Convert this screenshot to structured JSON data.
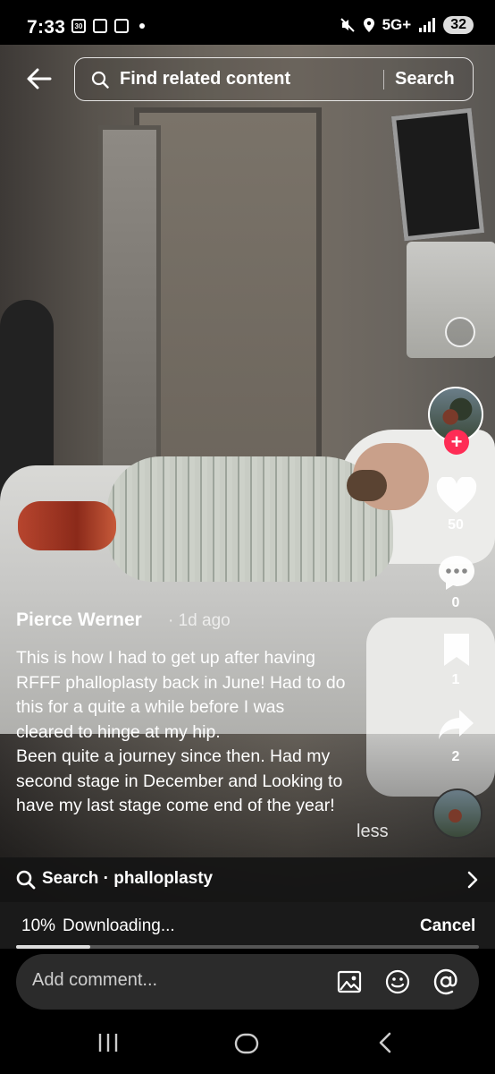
{
  "status_bar": {
    "time": "7:33",
    "date_badge": "30",
    "network": "5G+",
    "battery": "32"
  },
  "top_bar": {
    "search_placeholder": "Find related content",
    "search_button": "Search"
  },
  "rail": {
    "likes": "50",
    "comments": "0",
    "saves": "1",
    "shares": "2",
    "follow_symbol": "+"
  },
  "post": {
    "author": "Pierce Werner",
    "posted": "· 1d ago",
    "caption_lines": [
      "This is how I had to get up after having",
      "RFFF phalloplasty back in June! Had to do",
      "this for a quite a while before I was",
      "cleared to hinge at my hip.",
      "Been quite a journey since then. Had my",
      "second stage in December and Looking to",
      "have my last stage come end of the year!"
    ],
    "less": "less"
  },
  "related_search": {
    "label": "Search · phalloplasty"
  },
  "download": {
    "percent_label": "10%",
    "percent_value": 0.16,
    "status": "Downloading...",
    "cancel": "Cancel"
  },
  "comment_bar": {
    "placeholder": "Add comment..."
  },
  "icons": {
    "back": "arrow-left-icon",
    "search": "search-icon",
    "like": "heart-icon",
    "comment": "speech-bubble-icon",
    "save": "bookmark-icon",
    "share": "share-arrow-icon",
    "chevron": "chevron-right-icon",
    "image": "image-icon",
    "emoji": "emoji-icon",
    "mention": "at-icon"
  }
}
